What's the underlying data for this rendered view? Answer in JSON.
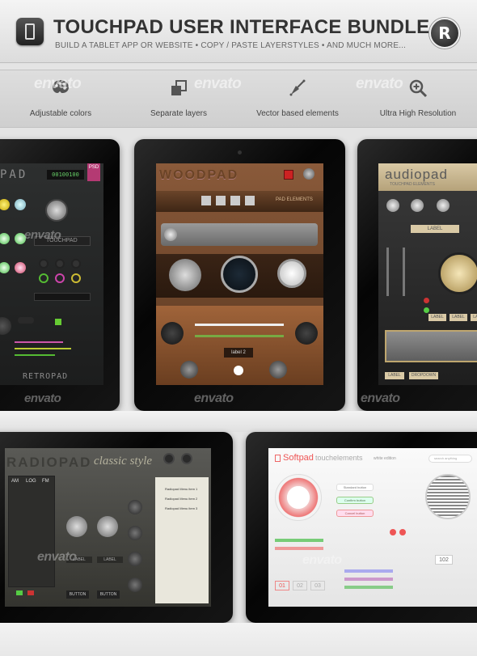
{
  "header": {
    "title": "TOUCHPAD USER INTERFACE BUNDLE",
    "subtitle": "BUILD A TABLET APP OR WEBSITE • COPY / PASTE LAYERSTYLES • AND MUCH MORE...",
    "logo_letter": "R",
    "app_icon": "tablet-icon"
  },
  "features": [
    {
      "label": "Adjustable colors",
      "icon": "palette-icon"
    },
    {
      "label": "Separate layers",
      "icon": "layers-icon"
    },
    {
      "label": "Vector based elements",
      "icon": "pen-tool-icon"
    },
    {
      "label": "Ultra High Resolution",
      "icon": "magnifier-icon"
    }
  ],
  "watermark": "envato",
  "screens": {
    "retro": {
      "title": "PAD",
      "footer": "RETROPAD",
      "psd_badge": "PSD",
      "display": "00100100",
      "mode_label": "TOUCHPAD"
    },
    "wood": {
      "title": "WOODPAD",
      "strip_label": "PAD ELEMENTS",
      "small_label": "label 2"
    },
    "audio": {
      "title": "audiopad",
      "subtitle": "TOUCHPAD ELEMENTS",
      "label_main": "LABEL",
      "labels": [
        "LABEL",
        "LABEL",
        "LABEL"
      ],
      "bottom_label": "LABEL",
      "dropdown": "DROPDOWN"
    },
    "radio": {
      "title": "RADIOPAD",
      "style": "classic style",
      "scale": [
        "AM",
        "LOG",
        "FM"
      ],
      "menu": [
        "Radiopad Menu item 1",
        "Radiopad Menu item 2",
        "Radiopad Menu item 3"
      ],
      "buttons": [
        "BUTTON",
        "BUTTON"
      ],
      "pills": [
        "LABEL",
        "LABEL"
      ]
    },
    "soft": {
      "title": "Softpad",
      "subtitle": "touchelements",
      "edition": "white edition",
      "search": "search anything",
      "buttons": [
        "Standard button",
        "Confirm button",
        "Cancel button"
      ],
      "numbers": [
        "01",
        "02",
        "03"
      ],
      "counter": "102"
    }
  }
}
